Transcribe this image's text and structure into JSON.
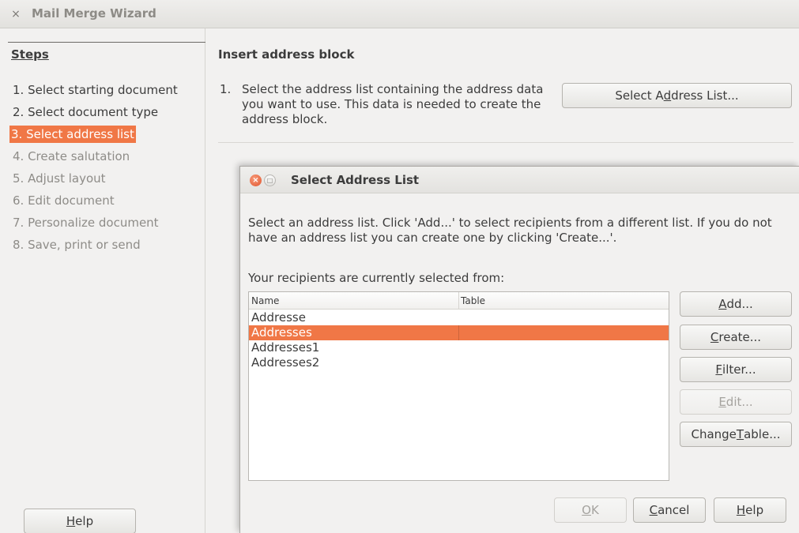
{
  "window": {
    "title": "Mail Merge Wizard",
    "close_glyph": "×"
  },
  "steps": {
    "heading": "Steps",
    "items": [
      {
        "label": "1. Select starting document",
        "state": "done"
      },
      {
        "label": "2. Select document type",
        "state": "done"
      },
      {
        "label": "3. Select address list",
        "state": "active"
      },
      {
        "label": "4. Create salutation",
        "state": "disabled"
      },
      {
        "label": "5. Adjust layout",
        "state": "disabled"
      },
      {
        "label": "6. Edit document",
        "state": "disabled"
      },
      {
        "label": "7. Personalize document",
        "state": "disabled"
      },
      {
        "label": "8. Save, print or send",
        "state": "disabled"
      }
    ]
  },
  "wizard": {
    "help_button": {
      "pre": "",
      "mnemonic": "H",
      "post": "elp"
    }
  },
  "main": {
    "heading": "Insert address block",
    "step_number": "1.",
    "instruction": "Select the address list containing the address data you want to use. This data is needed to create the address block.",
    "select_list_button": {
      "pre": "Select A",
      "mnemonic": "d",
      "post": "dress List..."
    }
  },
  "dialog": {
    "title": "Select Address List",
    "description": "Select an address list. Click 'Add...' to select recipients from a different list. If you do not have an address list you can create one by clicking 'Create...'.",
    "selected_from_label": "Your recipients are currently selected from:",
    "columns": {
      "name": "Name",
      "table": "Table"
    },
    "rows": [
      {
        "name": "Addresse",
        "table": "",
        "selected": false
      },
      {
        "name": "Addresses",
        "table": "",
        "selected": true
      },
      {
        "name": "Addresses1",
        "table": "",
        "selected": false
      },
      {
        "name": "Addresses2",
        "table": "",
        "selected": false
      }
    ],
    "buttons": {
      "add": {
        "pre": "",
        "mnemonic": "A",
        "post": "dd..."
      },
      "create": {
        "pre": "",
        "mnemonic": "C",
        "post": "reate..."
      },
      "filter": {
        "pre": "",
        "mnemonic": "F",
        "post": "ilter..."
      },
      "edit": {
        "pre": "",
        "mnemonic": "E",
        "post": "dit..."
      },
      "change_table": {
        "pre": "Change ",
        "mnemonic": "T",
        "post": "able..."
      },
      "ok": {
        "pre": "",
        "mnemonic": "O",
        "post": "K"
      },
      "cancel": {
        "pre": "",
        "mnemonic": "C",
        "post": "ancel"
      },
      "help": {
        "pre": "",
        "mnemonic": "H",
        "post": "elp"
      }
    }
  },
  "colors": {
    "accent": "#f07746",
    "window_bg": "#f2f1f0",
    "disabled_text": "#8e8c88"
  }
}
